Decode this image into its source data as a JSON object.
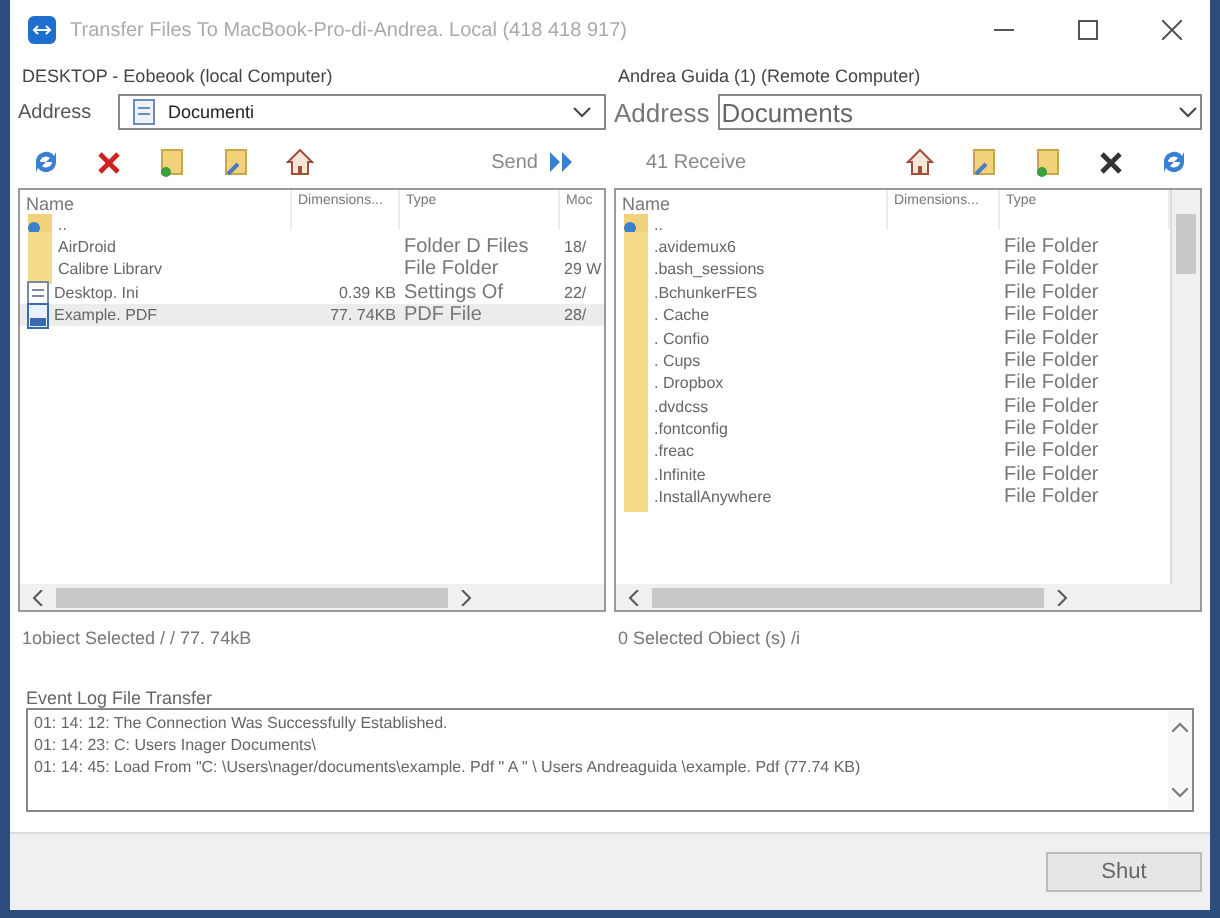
{
  "window": {
    "title": "Transfer Files To MacBook-Pro-di-Andrea. Local (418 418 917)"
  },
  "local": {
    "heading": "DESKTOP - Eobeook (local Computer)",
    "address_label": "Address",
    "address": "Documenti",
    "action": "Send",
    "columns": [
      "Name",
      "Dimensions...",
      "Type",
      "Moc"
    ],
    "rows": [
      {
        "kind": "up",
        "name": "..",
        "size": "",
        "type": "",
        "date": "",
        "selected": false
      },
      {
        "kind": "folder",
        "name": "AirDroid",
        "size": "",
        "type": "Folder D Files",
        "date": "18/",
        "selected": false
      },
      {
        "kind": "folder",
        "name": "Calibre Librarv",
        "size": "",
        "type": "File Folder",
        "date": "29 W",
        "selected": false
      },
      {
        "kind": "file",
        "name": "Desktop. Ini",
        "size": "0.39 KB",
        "type": "Settings Of",
        "date": "22/",
        "selected": false
      },
      {
        "kind": "pdf",
        "name": "Example. PDF",
        "size": "77. 74KB",
        "type": "PDF File",
        "date": "28/",
        "selected": true
      }
    ],
    "status": "1obiect Selected / / 77. 74kB"
  },
  "remote": {
    "heading": "Andrea Guida (1) (Remote Computer)",
    "address_label": "Address",
    "address": "Documents",
    "action": "41 Receive",
    "columns": [
      "Name",
      "Dimensions...",
      "Type"
    ],
    "rows": [
      {
        "kind": "up",
        "name": "..",
        "size": "",
        "type": "",
        "selected": false
      },
      {
        "kind": "folder",
        "name": ".avidemux6",
        "size": "",
        "type": "File Folder",
        "selected": false
      },
      {
        "kind": "folder",
        "name": ".bash_sessions",
        "size": "",
        "type": "File Folder",
        "selected": false
      },
      {
        "kind": "folder",
        "name": ".BchunkerFES",
        "size": "",
        "type": "File Folder",
        "selected": false
      },
      {
        "kind": "folder",
        "name": ". Cache",
        "size": "",
        "type": "File Folder",
        "selected": false
      },
      {
        "kind": "folder",
        "name": ". Confio",
        "size": "",
        "type": "File Folder",
        "selected": false
      },
      {
        "kind": "folder",
        "name": ". Cups",
        "size": "",
        "type": "File Folder",
        "selected": false
      },
      {
        "kind": "folder",
        "name": ". Dropbox",
        "size": "",
        "type": "File Folder",
        "selected": false
      },
      {
        "kind": "folder",
        "name": ".dvdcss",
        "size": "",
        "type": "File Folder",
        "selected": false
      },
      {
        "kind": "folder",
        "name": ".fontconfig",
        "size": "",
        "type": "File Folder",
        "selected": false
      },
      {
        "kind": "folder",
        "name": ".freac",
        "size": "",
        "type": "File Folder",
        "selected": false
      },
      {
        "kind": "folder",
        "name": ".Infinite",
        "size": "",
        "type": "File Folder",
        "selected": false
      },
      {
        "kind": "folder",
        "name": ".InstallAnywhere",
        "size": "",
        "type": "File Folder",
        "selected": false
      }
    ],
    "status": "0 Selected Obiect (s) /i"
  },
  "event_log": {
    "title": "Event Log File Transfer",
    "lines": [
      "01: 14: 12: The Connection Was Successfully Established.",
      "01: 14: 23: C: Users Inager Documents\\",
      "01: 14: 45: Load From \"C: \\Users\\nager/documents\\example. Pdf \" A \" \\ Users Andreaguida \\example. Pdf (77.74 KB)"
    ]
  },
  "buttons": [
    "Shut"
  ]
}
